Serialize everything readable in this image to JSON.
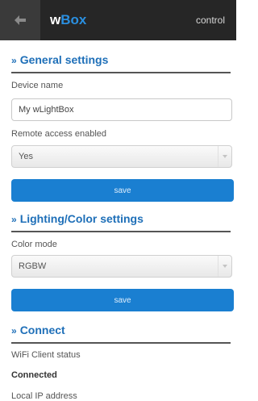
{
  "header": {
    "title_prefix": "w",
    "title_accent": "Box",
    "control_label": "control",
    "back_icon": "back-arrow-icon"
  },
  "general": {
    "section_title": "General settings",
    "device_name_label": "Device name",
    "device_name_value": "My wLightBox",
    "remote_access_label": "Remote access enabled",
    "remote_access_value": "Yes",
    "save_label": "save"
  },
  "lighting": {
    "section_title": "Lighting/Color settings",
    "color_mode_label": "Color mode",
    "color_mode_value": "RGBW",
    "save_label": "save"
  },
  "connect": {
    "section_title": "Connect",
    "wifi_status_label": "WiFi Client status",
    "wifi_status_value": "Connected",
    "local_ip_label": "Local IP address"
  },
  "colors": {
    "accent": "#1e6fb8",
    "button": "#1a7fd1",
    "topbar": "#262626"
  }
}
